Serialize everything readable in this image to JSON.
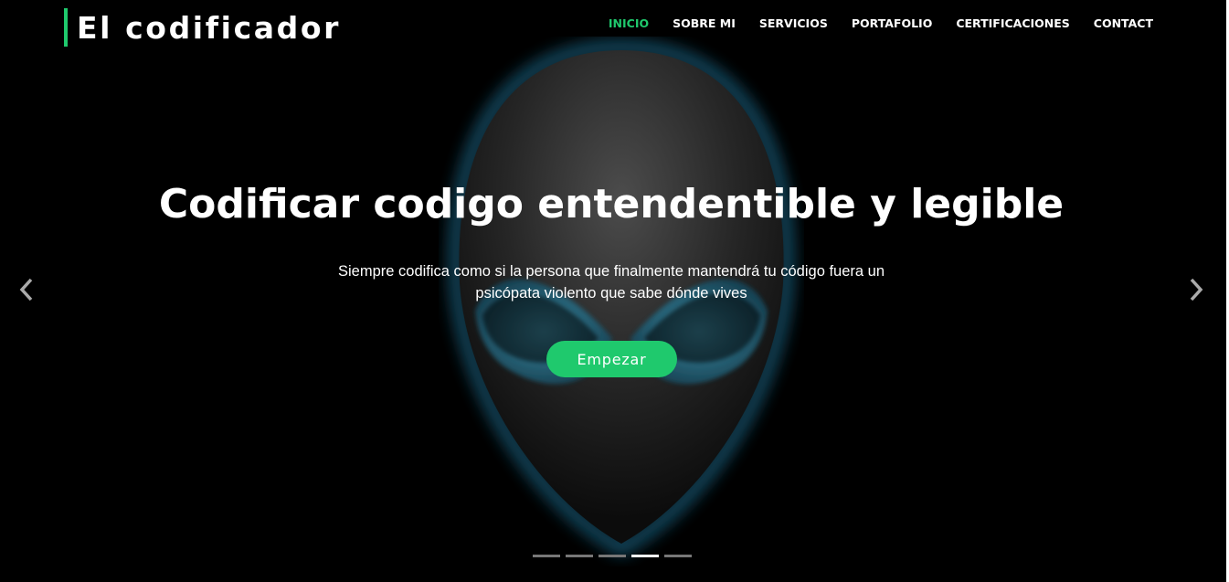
{
  "brand": {
    "name": "El codificador",
    "accent_color": "#1fc96d"
  },
  "nav": {
    "items": [
      {
        "label": "INICIO",
        "active": true
      },
      {
        "label": "SOBRE MI",
        "active": false
      },
      {
        "label": "SERVICIOS",
        "active": false
      },
      {
        "label": "PORTAFOLIO",
        "active": false
      },
      {
        "label": "CERTIFICACIONES",
        "active": false
      },
      {
        "label": "CONTACT",
        "active": false
      }
    ]
  },
  "hero": {
    "headline": "Codificar codigo entendentible y legible",
    "subtext": "Siempre codifica como si la persona que finalmente mantendrá tu código fuera un psicópata violento que sabe dónde vives",
    "cta_label": "Empezar",
    "background_image": "alien-head",
    "carousel": {
      "prev_icon": "chevron-left-icon",
      "next_icon": "chevron-right-icon",
      "slide_count": 5,
      "active_slide": 4
    }
  }
}
